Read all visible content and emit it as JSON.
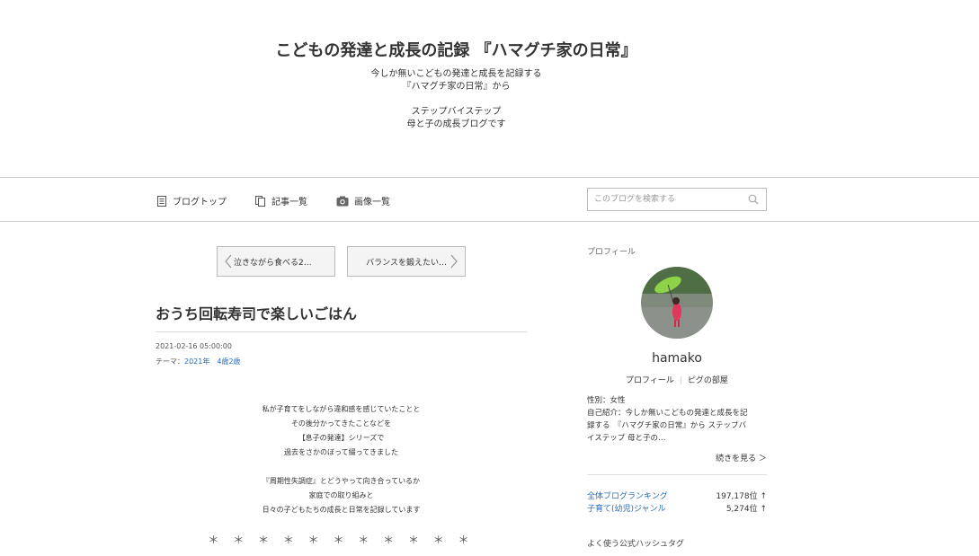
{
  "header": {
    "title": "こどもの発達と成長の記録 『ハマグチ家の日常』",
    "description_lines": [
      "今しか無いこどもの発達と成長を記録する",
      "『ハマグチ家の日常』から",
      "",
      "ステップバイステップ",
      "母と子の成長ブログです"
    ]
  },
  "nav": {
    "items": [
      {
        "label": "ブログトップ",
        "icon": "document-icon"
      },
      {
        "label": "記事一覧",
        "icon": "copy-icon"
      },
      {
        "label": "画像一覧",
        "icon": "camera-icon"
      }
    ],
    "search": {
      "placeholder": "このブログを検索する"
    }
  },
  "pager": {
    "prev_label": "泣きながら食べる2…",
    "next_label": "バランスを鍛えたい…"
  },
  "article": {
    "title": "おうち回転寿司で楽しいごはん",
    "date": "2021-02-16 05:00:00",
    "theme_prefix": "テーマ：",
    "themes": [
      "2021年",
      "4歳2歳"
    ],
    "body_lines": [
      "私が子育てをしながら違和感を感じていたことと",
      "その後分かってきたことなどを",
      "【息子の発達】シリーズで",
      "過去をさかのぼって綴ってきました",
      "",
      "『周期性失調症』とどうやって向き合っているか",
      "家庭での取り組みと",
      "日々の子どもたちの成長と日常を記録しています"
    ],
    "separator": "＊ ＊ ＊ ＊ ＊ ＊ ＊ ＊ ＊ ＊ ＊"
  },
  "sidebar": {
    "profile_heading": "プロフィール",
    "username": "hamako",
    "profile_link": "プロフィール",
    "room_link": "ピグの部屋",
    "gender": "性別：女性",
    "intro_lines": [
      "自己紹介：今しか無いこどもの発達と成長を記",
      "録する　『ハマグチ家の日常』から ステップバ",
      "イステップ 母と子の…"
    ],
    "more_label": "続きを見る ＞",
    "rankings": [
      {
        "label": "全体ブログランキング",
        "value": "197,178位 ↑"
      },
      {
        "label": "子育て(幼児)ジャンル",
        "value": "5,274位 ↑"
      }
    ],
    "hashtag_heading": "よく使う公式ハッシュタグ"
  },
  "colors": {
    "link": "#2b6db5",
    "border": "#cccccc"
  }
}
